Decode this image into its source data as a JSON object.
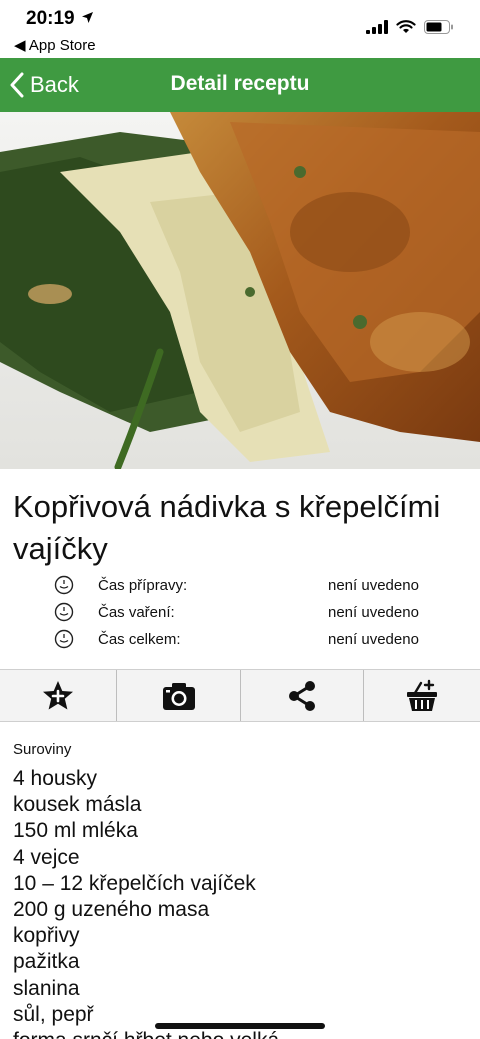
{
  "status_bar": {
    "time": "20:19",
    "back_app": "◀ App Store"
  },
  "nav": {
    "back_label": "Back",
    "title": "Detail receptu",
    "color": "#3f9a41"
  },
  "recipe": {
    "title": "Kopřivová nádivka s křepelčími vajíčky",
    "times": [
      {
        "label": "Čas přípravy:",
        "value": "není uvedeno",
        "icon": "clock-icon"
      },
      {
        "label": "Čas vaření:",
        "value": "není uvedeno",
        "icon": "clock-icon"
      },
      {
        "label": "Čas celkem:",
        "value": "není uvedeno",
        "icon": "clock-icon"
      }
    ]
  },
  "actions": [
    {
      "name": "favorite-button",
      "icon": "star-plus-icon"
    },
    {
      "name": "photo-button",
      "icon": "camera-icon"
    },
    {
      "name": "share-button",
      "icon": "share-icon"
    },
    {
      "name": "shopping-list-button",
      "icon": "basket-plus-icon"
    }
  ],
  "ingredients": {
    "label": "Suroviny",
    "items": [
      "4 housky",
      "kousek másla",
      "150 ml mléka",
      "4 vejce",
      "10 – 12 křepelčích vajíček",
      "200 g uzeného masa",
      "kopřivy",
      "pažitka",
      "slanina",
      "sůl, pepř",
      "forma srnčí hřbet nebo velká"
    ]
  }
}
